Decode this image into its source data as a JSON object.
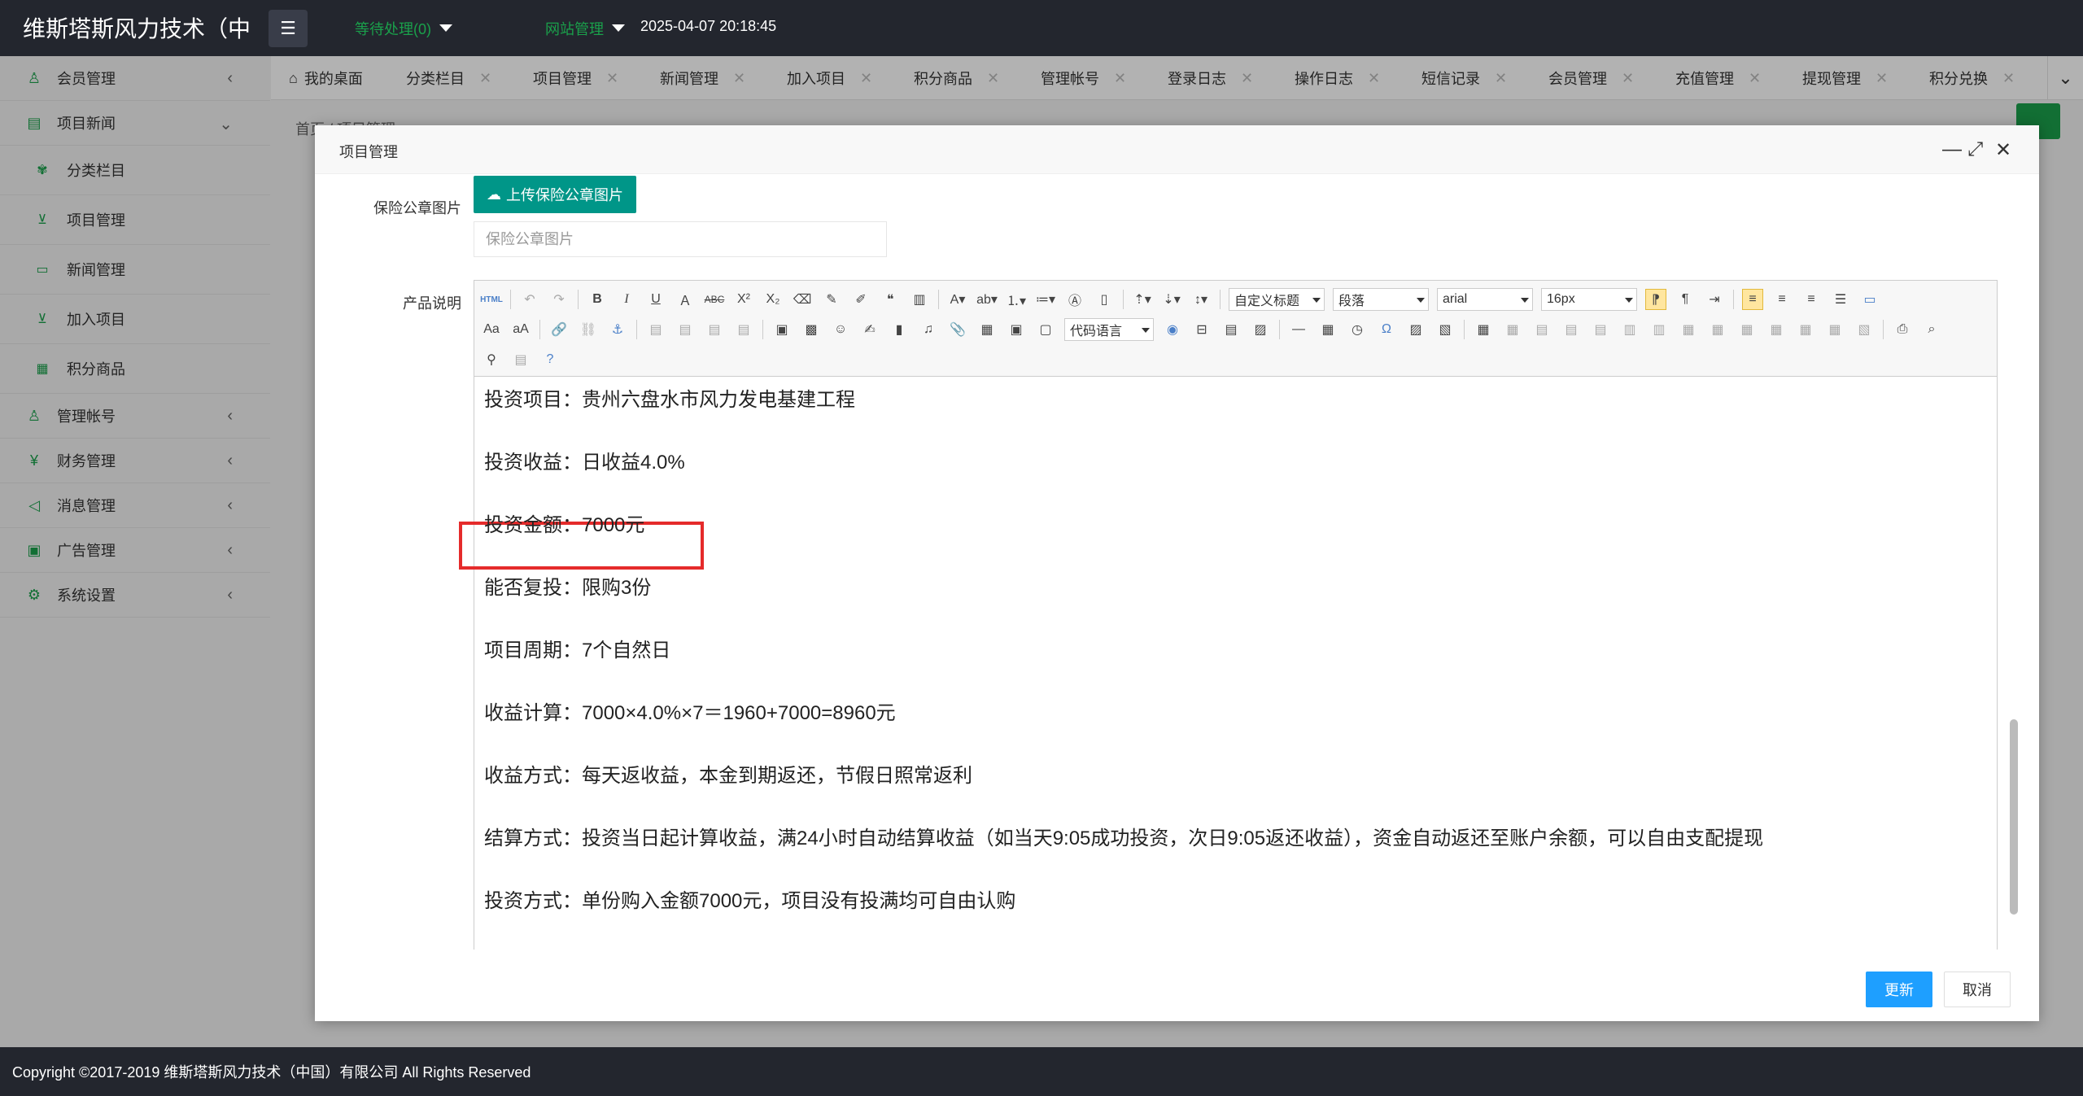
{
  "header": {
    "brand": "维斯塔斯风力技术（中",
    "pending": "等待处理(0)",
    "site_manage": "网站管理",
    "datetime": "2025-04-07 20:18:45"
  },
  "sidebar": {
    "items": [
      {
        "label": "会员管理",
        "icon": "user-icon"
      },
      {
        "label": "项目新闻",
        "icon": "book-icon"
      },
      {
        "label": "管理帐号",
        "icon": "user-icon"
      },
      {
        "label": "财务管理",
        "icon": "yen-icon"
      },
      {
        "label": "消息管理",
        "icon": "sound-icon"
      },
      {
        "label": "广告管理",
        "icon": "image-icon"
      },
      {
        "label": "系统设置",
        "icon": "gear-icon"
      }
    ],
    "sub_items": [
      {
        "label": "分类栏目"
      },
      {
        "label": "项目管理"
      },
      {
        "label": "新闻管理"
      },
      {
        "label": "加入项目"
      },
      {
        "label": "积分商品"
      }
    ]
  },
  "tabs": [
    {
      "label": "我的桌面"
    },
    {
      "label": "分类栏目"
    },
    {
      "label": "项目管理"
    },
    {
      "label": "新闻管理"
    },
    {
      "label": "加入项目"
    },
    {
      "label": "积分商品"
    },
    {
      "label": "管理帐号"
    },
    {
      "label": "登录日志"
    },
    {
      "label": "操作日志"
    },
    {
      "label": "短信记录"
    },
    {
      "label": "会员管理"
    },
    {
      "label": "充值管理"
    },
    {
      "label": "提现管理"
    },
    {
      "label": "积分兑换"
    }
  ],
  "page": {
    "breadcrumb": "首页 / 项目管理"
  },
  "modal": {
    "title": "项目管理",
    "seal_label": "保险公章图片",
    "upload_button": "上传保险公章图片",
    "seal_placeholder": "保险公章图片",
    "desc_label": "产品说明",
    "toolbar": {
      "heading_select": "自定义标题",
      "paragraph_select": "段落",
      "font_select": "arial",
      "size_select": "16px",
      "code_select": "代码语言"
    },
    "content": [
      "投资项目：贵州六盘水市风力发电基建工程",
      "投资收益：日收益4.0%",
      "投资金额：7000元",
      "能否复投：限购3份",
      "项目周期：7个自然日",
      "收益计算：7000×4.0%×7＝1960+7000=8960元",
      "收益方式：每天返收益，本金到期返还，节假日照常返利",
      "结算方式：投资当日起计算收益，满24小时自动结算收益（如当天9:05成功投资，次日9:05返还收益），资金自动返还至账户余额，可以自由支配提现",
      "投资方式：单份购入金额7000元，项目没有投满均可自由认购"
    ],
    "update_button": "更新",
    "cancel_button": "取消"
  },
  "footer": {
    "copyright": "Copyright ©2017-2019 维斯塔斯风力技术（中国）有限公司 All Rights Reserved"
  }
}
